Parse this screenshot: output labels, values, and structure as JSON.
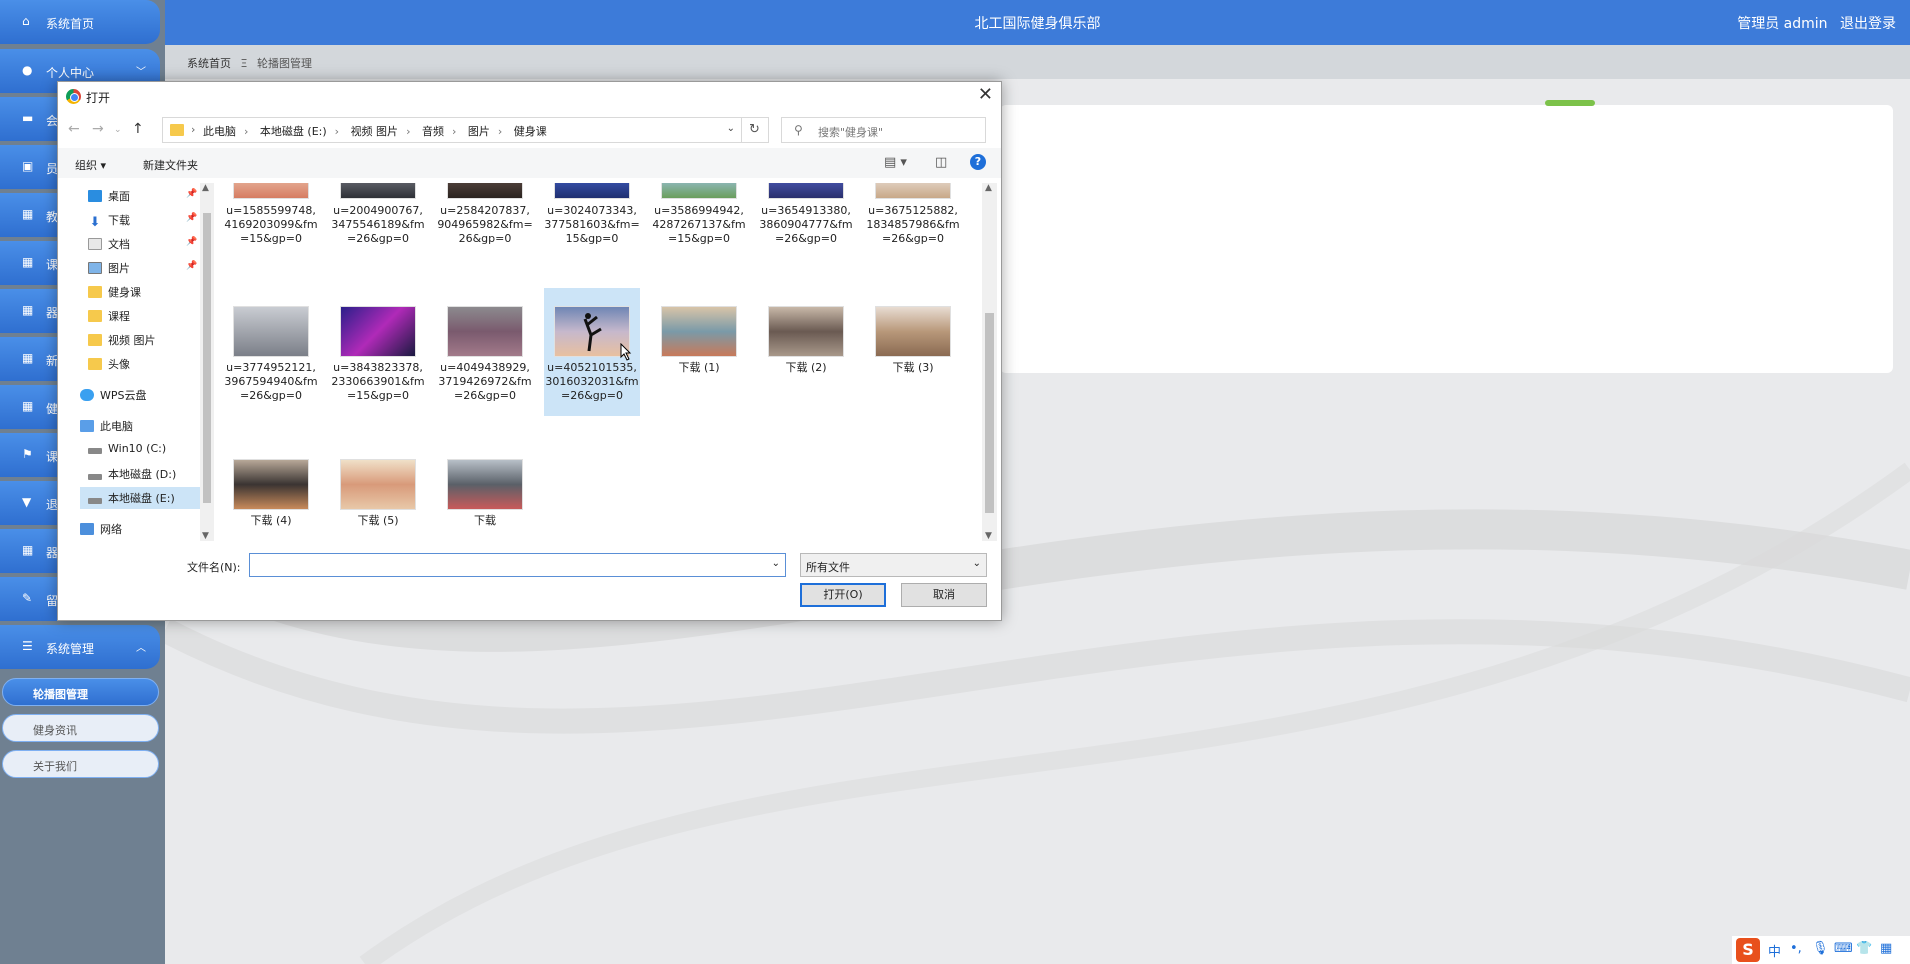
{
  "app": {
    "title": "北工国际健身俱乐部",
    "user_label": "管理员 admin",
    "logout": "退出登录"
  },
  "breadcrumb": {
    "home": "系统首页",
    "sep": "Ξ",
    "current": "轮播图管理"
  },
  "sidebar": {
    "items": [
      {
        "label": "系统首页",
        "icon": "home-icon"
      },
      {
        "label": "个人中心",
        "icon": "user-icon"
      },
      {
        "label": "会",
        "icon": "monitor-icon"
      },
      {
        "label": "员",
        "icon": "clipboard-icon"
      },
      {
        "label": "教",
        "icon": "grid-icon"
      },
      {
        "label": "课",
        "icon": "table-icon"
      },
      {
        "label": "器",
        "icon": "grid-icon"
      },
      {
        "label": "新",
        "icon": "grid-icon"
      },
      {
        "label": "健",
        "icon": "grid-icon"
      },
      {
        "label": "课",
        "icon": "flag-icon"
      },
      {
        "label": "退",
        "icon": "pin-icon"
      },
      {
        "label": "器",
        "icon": "grid-icon"
      },
      {
        "label": "留",
        "icon": "edit-icon"
      }
    ],
    "system": {
      "label": "系统管理"
    },
    "subs": [
      {
        "label": "轮播图管理",
        "active": true
      },
      {
        "label": "健身资讯"
      },
      {
        "label": "关于我们"
      }
    ]
  },
  "dialog": {
    "title": "打开",
    "path": [
      "此电脑",
      "本地磁盘 (E:)",
      "视频 图片",
      "音频",
      "图片",
      "健身课"
    ],
    "search_placeholder": "搜索\"健身课\"",
    "organize": "组织 ▾",
    "new_folder": "新建文件夹",
    "tree": [
      {
        "label": "桌面",
        "icon": "desktop-icon",
        "pinned": true
      },
      {
        "label": "下载",
        "icon": "download-icon",
        "pinned": true
      },
      {
        "label": "文档",
        "icon": "document-icon",
        "pinned": true
      },
      {
        "label": "图片",
        "icon": "picture-icon",
        "pinned": true
      },
      {
        "label": "健身课",
        "icon": "folder-icon"
      },
      {
        "label": "课程",
        "icon": "folder-icon"
      },
      {
        "label": "视频 图片",
        "icon": "folder-icon"
      },
      {
        "label": "头像",
        "icon": "folder-icon"
      },
      {
        "label": "WPS云盘",
        "icon": "cloud-icon"
      },
      {
        "label": "此电脑",
        "icon": "computer-icon"
      },
      {
        "label": "Win10 (C:)",
        "icon": "drive-icon"
      },
      {
        "label": "本地磁盘 (D:)",
        "icon": "drive-icon"
      },
      {
        "label": "本地磁盘 (E:)",
        "icon": "drive-icon",
        "selected": true
      },
      {
        "label": "网络",
        "icon": "network-icon"
      }
    ],
    "files_row1": [
      "u=1585599748,4169203099&fm=15&gp=0",
      "u=2004900767,3475546189&fm=26&gp=0",
      "u=2584207837,904965982&fm=26&gp=0",
      "u=3024073343,377581603&fm=15&gp=0",
      "u=3586994942,4287267137&fm=15&gp=0",
      "u=3654913380,3860904777&fm=26&gp=0",
      "u=3675125882,1834857986&fm=26&gp=0"
    ],
    "files_row2": [
      "u=3774952121,3967594940&fm=26&gp=0",
      "u=3843823378,2330663901&fm=15&gp=0",
      "u=4049438929,3719426972&fm=26&gp=0",
      "u=4052101535,3016032031&fm=26&gp=0",
      "下载 (1)",
      "下载 (2)",
      "下载 (3)"
    ],
    "files_row3": [
      "下载 (4)",
      "下载 (5)",
      "下载"
    ],
    "filename_label": "文件名(N):",
    "filename_value": "",
    "filetype": "所有文件",
    "open": "打开(O)",
    "cancel": "取消"
  },
  "ime": {
    "lang": "中"
  },
  "colors": {
    "accent": "#3d7bd9",
    "selection": "#cce4f7"
  }
}
